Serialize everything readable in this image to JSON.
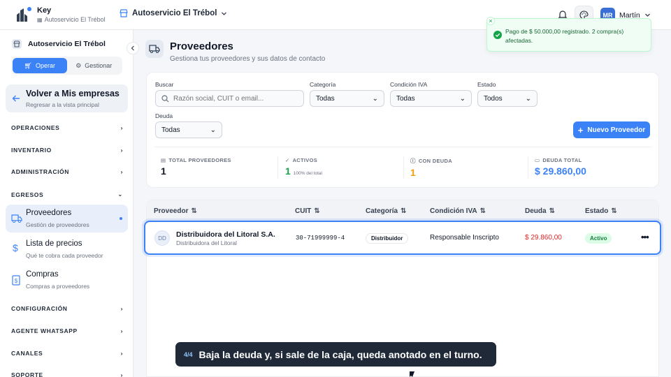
{
  "header": {
    "brand": "Key",
    "store_sub": "Autoservicio El Trébol",
    "store_switch": "Autoservicio El Trébol",
    "user_initials": "MR",
    "user_name": "Martín"
  },
  "sidebar": {
    "store": "Autoservicio El Trébol",
    "mode_operar": "Operar",
    "mode_gestionar": "Gestionar",
    "back_title": "Volver a Mis empresas",
    "back_sub": "Regresar a la vista principal",
    "sections": {
      "operaciones": "OPERACIONES",
      "inventario": "INVENTARIO",
      "administracion": "ADMINISTRACIÓN",
      "egresos": "EGRESOS",
      "configuracion": "CONFIGURACIÓN",
      "agente": "AGENTE WHATSAPP",
      "canales": "CANALES",
      "soporte": "SOPORTE"
    },
    "items": [
      {
        "title": "Proveedores",
        "sub": "Gestión de proveedores"
      },
      {
        "title": "Lista de precios",
        "sub": "Qué te cobra cada proveedor"
      },
      {
        "title": "Compras",
        "sub": "Compras a proveedores"
      }
    ]
  },
  "page": {
    "title": "Proveedores",
    "subtitle": "Gestiona tus proveedores y sus datos de contacto"
  },
  "filters": {
    "search_label": "Buscar",
    "search_placeholder": "Razón social, CUIT o email...",
    "categoria_label": "Categoría",
    "categoria_value": "Todas",
    "iva_label": "Condición IVA",
    "iva_value": "Todas",
    "estado_label": "Estado",
    "estado_value": "Todos",
    "deuda_label": "Deuda",
    "deuda_value": "Todas",
    "new_button": "Nuevo Proveedor"
  },
  "stats": {
    "total_label": "TOTAL PROVEEDORES",
    "total_value": "1",
    "activos_label": "ACTIVOS",
    "activos_value": "1",
    "activos_note": "100% del total",
    "deuda_label": "CON DEUDA",
    "deuda_value": "1",
    "deuda_total_label": "DEUDA TOTAL",
    "deuda_total_value": "$ 29.860,00"
  },
  "table": {
    "headers": [
      "Proveedor",
      "CUIT",
      "Categoría",
      "Condición IVA",
      "Deuda",
      "Estado"
    ],
    "rows": [
      {
        "initials": "DD",
        "name": "Distribuidora del Litoral S.A.",
        "alias": "Distribuidora del Litoral",
        "cuit": "30-71999999-4",
        "categoria": "Distribuidor",
        "iva": "Responsable Inscripto",
        "deuda": "$ 29.860,00",
        "estado": "Activo",
        "more": "•••"
      }
    ]
  },
  "toast": {
    "message": "Pago de $ 50.000,00 registrado. 2 compra(s) afectadas.",
    "close": "×"
  },
  "caption": {
    "step": "4/4",
    "text": "Baja la deuda y, si sale de la caja, queda anotado en el turno."
  },
  "colors": {
    "accent": "#3b82f6",
    "success": "#16a34a",
    "danger": "#dc2626",
    "warning": "#f59e0b"
  }
}
